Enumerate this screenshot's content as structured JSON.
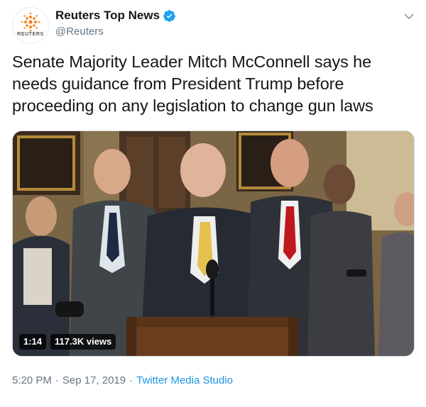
{
  "account": {
    "name": "Reuters Top News",
    "handle": "@Reuters",
    "avatar_wordmark": "REUTERS",
    "verified": true,
    "avatar_icon": "reuters-logo-icon"
  },
  "tweet": {
    "text": "Senate Majority Leader Mitch McConnell says he needs guidance from President Trump before proceeding on any legislation to change gun laws"
  },
  "video": {
    "duration": "1:14",
    "views": "117.3K views"
  },
  "footer": {
    "time": "5:20 PM",
    "date": "Sep 17, 2019",
    "separator": "·",
    "source": "Twitter Media Studio"
  },
  "colors": {
    "text": "#14171a",
    "secondary": "#657786",
    "link": "#1b95e0",
    "verified": "#1da1f2",
    "logo_orange": "#f58220"
  }
}
